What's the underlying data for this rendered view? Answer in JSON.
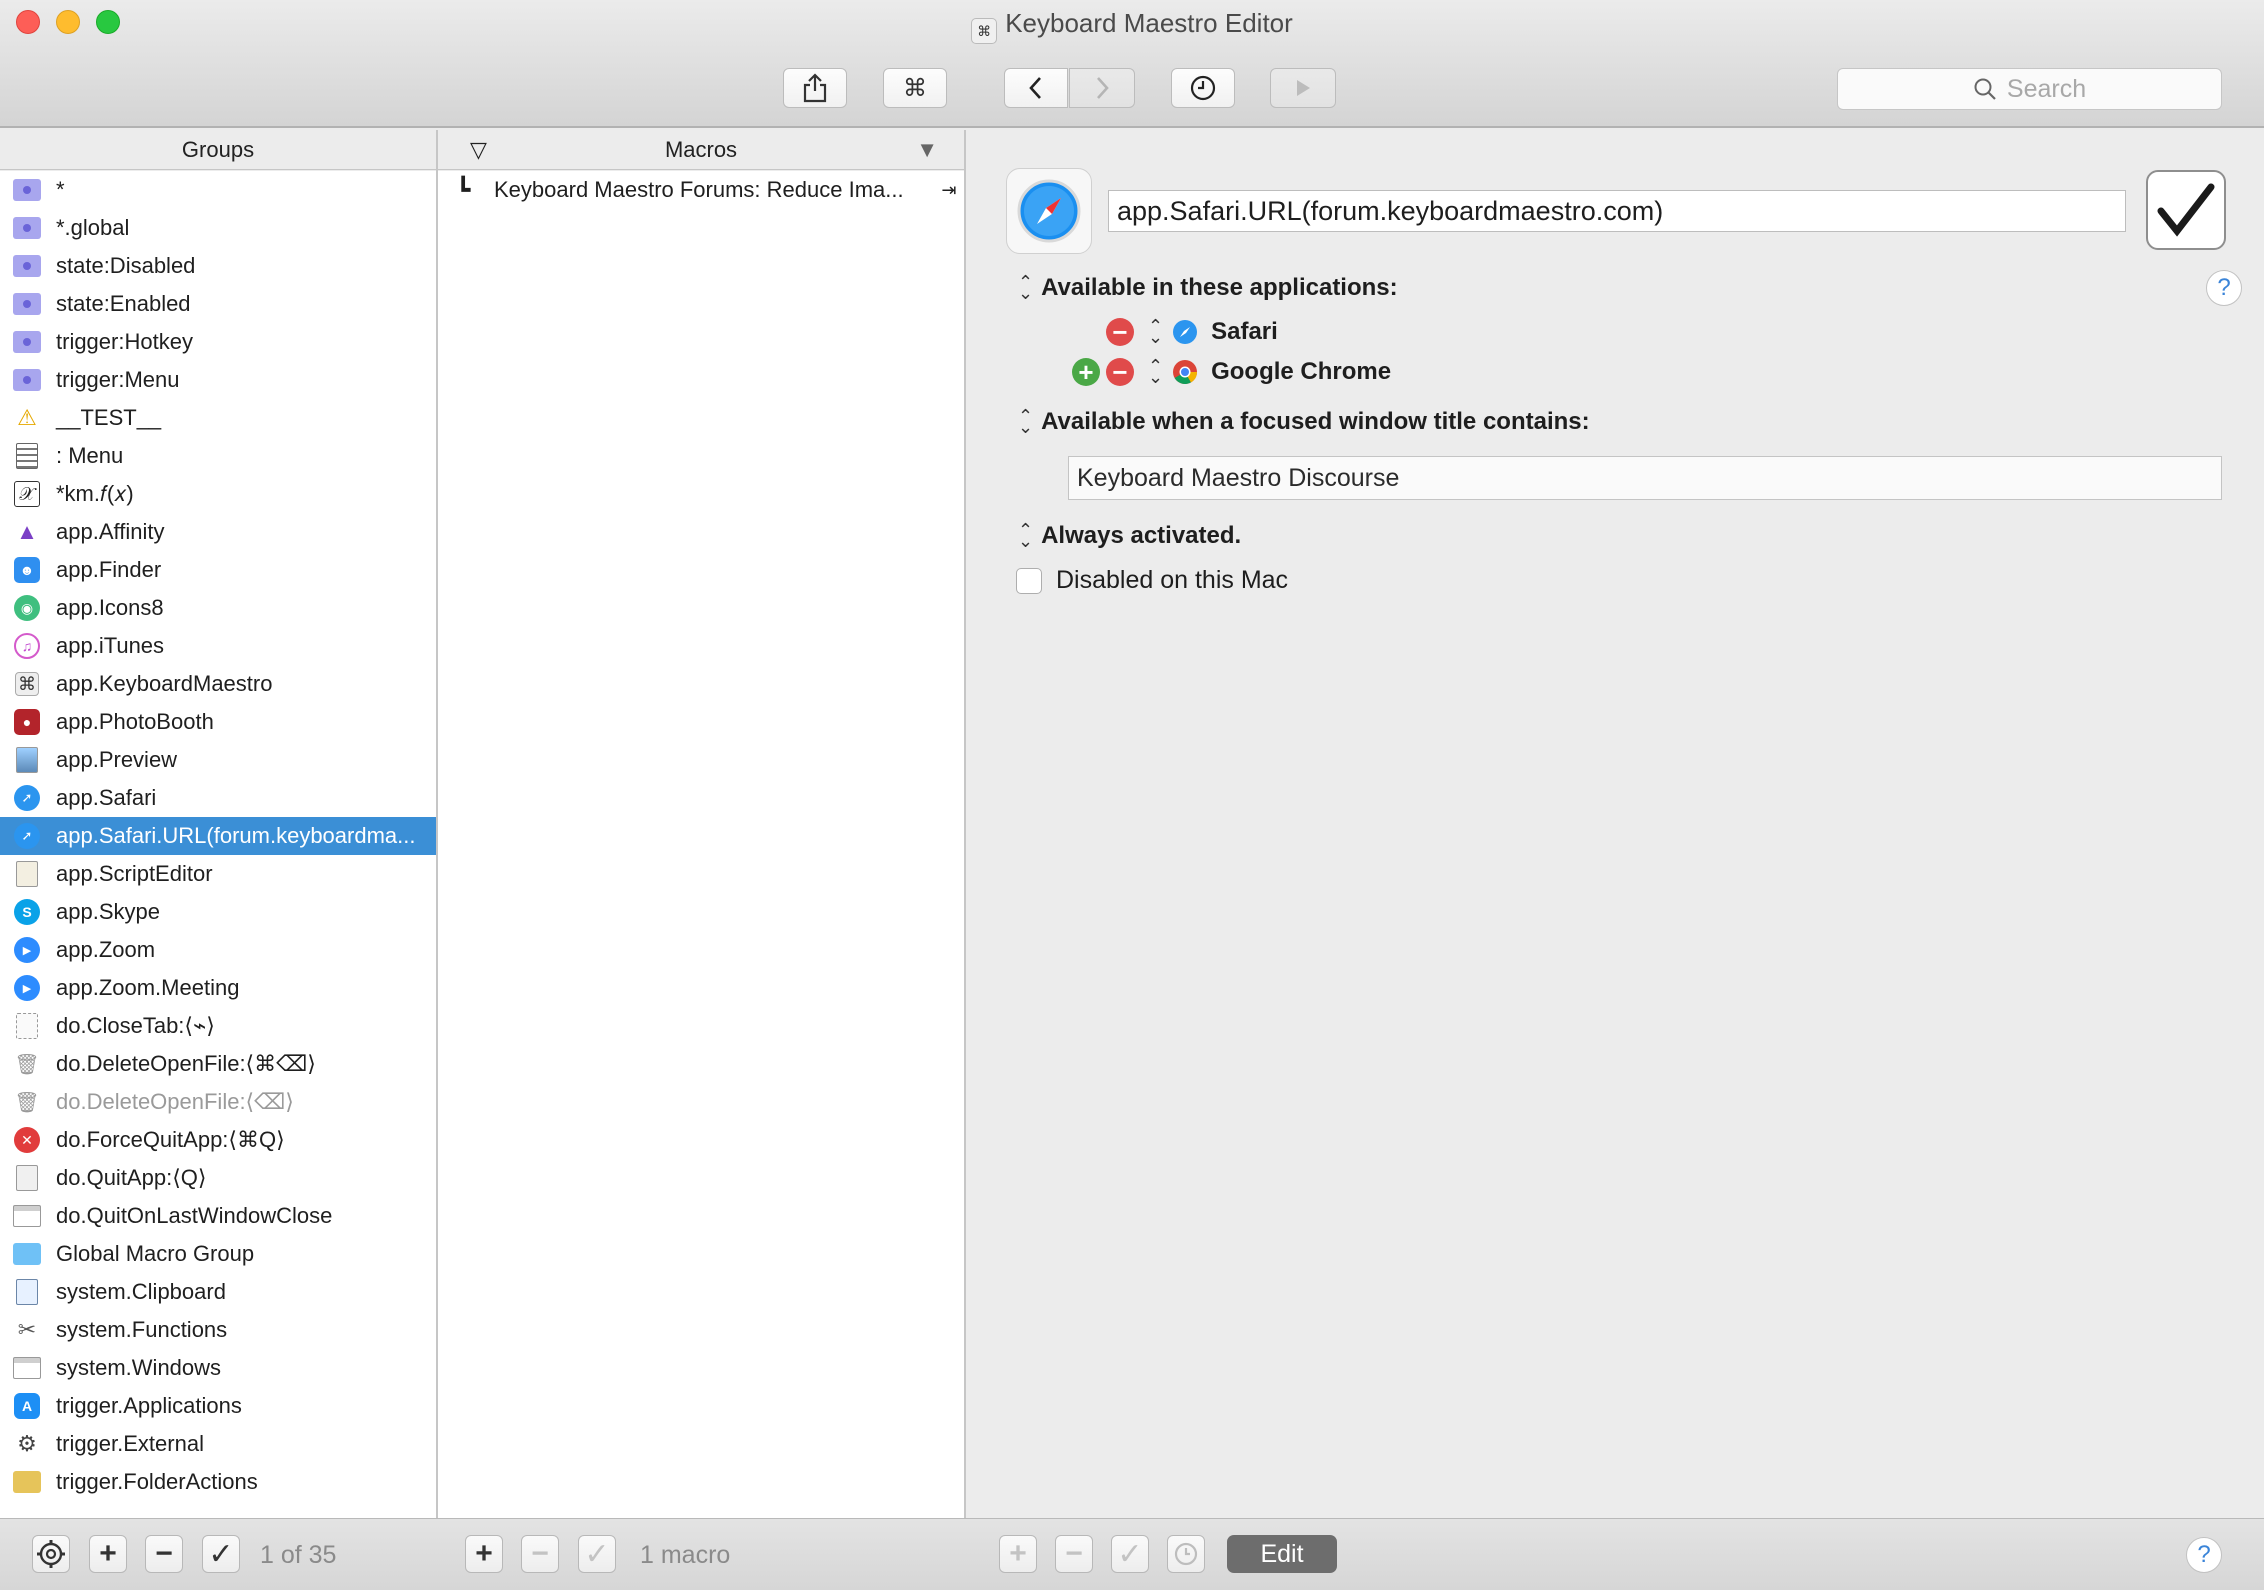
{
  "window": {
    "title": "Keyboard Maestro Editor"
  },
  "toolbar": {
    "search_placeholder": "Search"
  },
  "columns": {
    "groups_header": "Groups",
    "macros_header": "Macros"
  },
  "groups": [
    {
      "label": "*",
      "icon": "folder-icon"
    },
    {
      "label": "*.global",
      "icon": "folder-icon"
    },
    {
      "label": "state:Disabled",
      "icon": "folder-icon"
    },
    {
      "label": "state:Enabled",
      "icon": "folder-icon"
    },
    {
      "label": "trigger:Hotkey",
      "icon": "folder-icon"
    },
    {
      "label": "trigger:Menu",
      "icon": "folder-icon"
    },
    {
      "label": "__TEST__",
      "icon": "warning-icon"
    },
    {
      "label": ": Menu",
      "icon": "list-icon"
    },
    {
      "label": "*km.𝑓(𝑥)",
      "icon": "function-icon"
    },
    {
      "label": "app.Affinity",
      "icon": "affinity-icon"
    },
    {
      "label": "app.Finder",
      "icon": "finder-icon"
    },
    {
      "label": "app.Icons8",
      "icon": "icons8-icon"
    },
    {
      "label": "app.iTunes",
      "icon": "itunes-icon"
    },
    {
      "label": "app.KeyboardMaestro",
      "icon": "keyboard-maestro-icon"
    },
    {
      "label": "app.PhotoBooth",
      "icon": "photobooth-icon"
    },
    {
      "label": "app.Preview",
      "icon": "preview-icon"
    },
    {
      "label": "app.Safari",
      "icon": "safari-icon"
    },
    {
      "label": "app.Safari.URL(forum.keyboardma...",
      "icon": "safari-icon",
      "selected": true
    },
    {
      "label": "app.ScriptEditor",
      "icon": "script-editor-icon"
    },
    {
      "label": "app.Skype",
      "icon": "skype-icon"
    },
    {
      "label": "app.Zoom",
      "icon": "zoom-icon"
    },
    {
      "label": "app.Zoom.Meeting",
      "icon": "zoom-icon"
    },
    {
      "label": "do.CloseTab:⟨⌁⟩",
      "icon": "close-tab-icon"
    },
    {
      "label": "do.DeleteOpenFile:⟨⌘⌫⟩",
      "icon": "trash-icon"
    },
    {
      "label": "do.DeleteOpenFile:⟨⌫⟩",
      "icon": "trash-icon",
      "dim": true
    },
    {
      "label": "do.ForceQuitApp:⟨⌘Q⟩",
      "icon": "force-quit-icon"
    },
    {
      "label": "do.QuitApp:⟨Q⟩",
      "icon": "quit-app-icon"
    },
    {
      "label": "do.QuitOnLastWindowClose",
      "icon": "window-icon"
    },
    {
      "label": "Global Macro Group",
      "icon": "blue-folder-icon"
    },
    {
      "label": "system.Clipboard",
      "icon": "clipboard-icon"
    },
    {
      "label": "system.Functions",
      "icon": "tools-icon"
    },
    {
      "label": "system.Windows",
      "icon": "window-icon"
    },
    {
      "label": "trigger.Applications",
      "icon": "app-store-icon"
    },
    {
      "label": "trigger.External",
      "icon": "gear-icon"
    },
    {
      "label": "trigger.FolderActions",
      "icon": "folder-action-icon"
    }
  ],
  "macros": [
    {
      "label": "Keyboard Maestro Forums: Reduce Ima...",
      "icon": "macro-icon",
      "trigger": "⇥"
    }
  ],
  "editor": {
    "group_name": "app.Safari.URL(forum.keyboardmaestro.com)",
    "available_apps_label": "Available in these applications:",
    "apps": [
      "Safari",
      "Google Chrome"
    ],
    "window_title_label": "Available when a focused window title contains:",
    "window_title_value": "Keyboard Maestro Discourse",
    "always_activated_label": "Always activated.",
    "disabled_label": "Disabled on this Mac",
    "help": "?"
  },
  "bottom": {
    "groups_count": "1 of 35",
    "macros_count": "1 macro",
    "edit_label": "Edit",
    "help": "?"
  },
  "colors": {
    "selection": "#3b8fd6",
    "minus": "#e04b4b",
    "plus": "#4aa846"
  }
}
